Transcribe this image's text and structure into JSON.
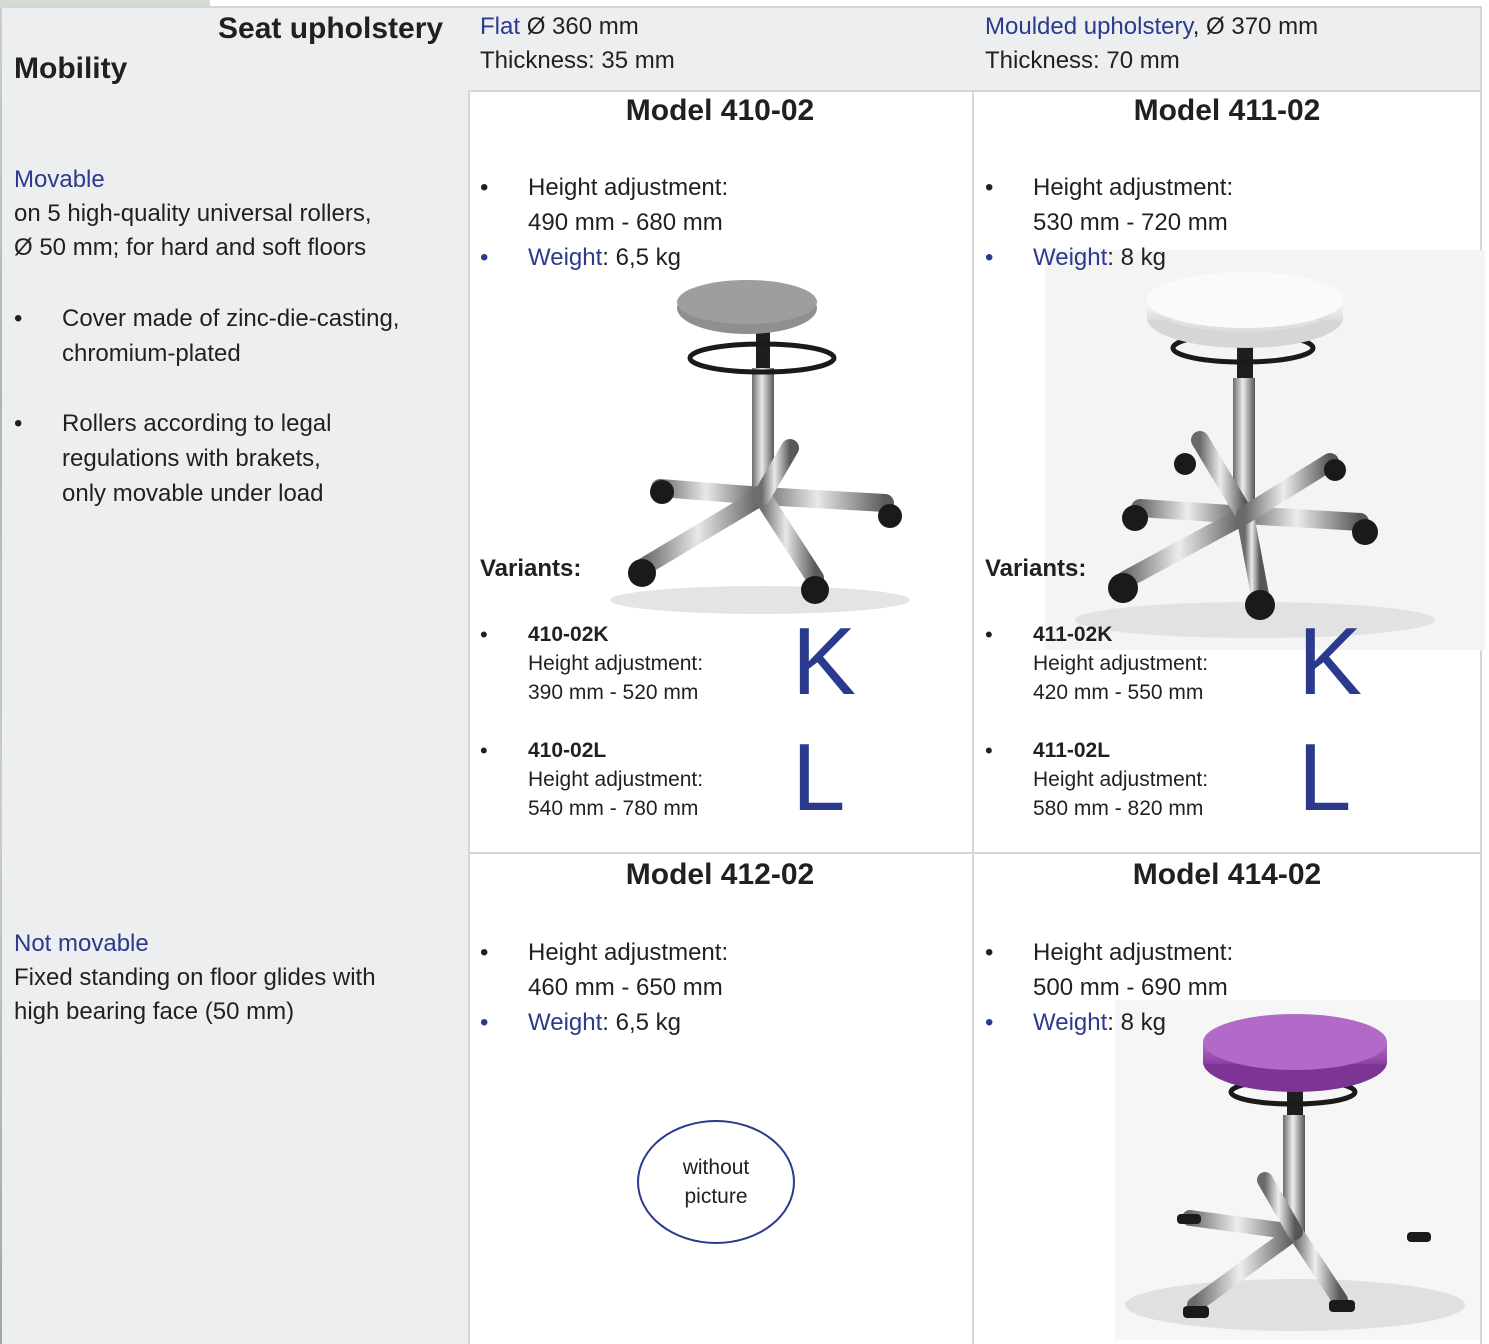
{
  "header": {
    "seat_upholstery_label": "Seat upholstery",
    "mobility_label": "Mobility",
    "flat": {
      "name": "Flat",
      "dimension": "Ø 360 mm",
      "thickness": "Thickness: 35 mm"
    },
    "moulded": {
      "name": "Moulded upholstery",
      "dimension": ", Ø 370 mm",
      "thickness": "Thickness: 70 mm"
    }
  },
  "mobility": {
    "movable": {
      "title": "Movable",
      "line1": "on 5 high-quality universal rollers,",
      "line2": "Ø 50 mm; for hard and soft floors",
      "bullets": [
        {
          "line1": "Cover made of zinc-die-casting,",
          "line2": "chromium-plated"
        },
        {
          "line1": "Rollers according to legal",
          "line2": "regulations with brakets,",
          "line3": "only movable under load"
        }
      ]
    },
    "not_movable": {
      "title": "Not movable",
      "line1": "Fixed standing on floor glides with",
      "line2": "high bearing face (50 mm)"
    }
  },
  "models": {
    "m41002": {
      "title": "Model 410-02",
      "height_label": "Height adjustment:",
      "height_value": "490 mm - 680 mm",
      "weight_label": "Weight",
      "weight_value": ": 6,5 kg",
      "variants_label": "Variants:",
      "variants": [
        {
          "code": "410-02K",
          "label": "Height adjustment:",
          "range": "390 mm - 520 mm",
          "letter": "K"
        },
        {
          "code": "410-02L",
          "label": "Height adjustment:",
          "range": "540 mm - 780 mm",
          "letter": "L"
        }
      ]
    },
    "m41102": {
      "title": "Model 411-02",
      "height_label": "Height adjustment:",
      "height_value": "530 mm - 720 mm",
      "weight_label": "Weight",
      "weight_value": ": 8 kg",
      "variants_label": "Variants:",
      "variants": [
        {
          "code": "411-02K",
          "label": "Height adjustment:",
          "range": "420 mm - 550 mm",
          "letter": "K"
        },
        {
          "code": "411-02L",
          "label": "Height adjustment:",
          "range": "580 mm - 820 mm",
          "letter": "L"
        }
      ]
    },
    "m41202": {
      "title": "Model 412-02",
      "height_label": "Height adjustment:",
      "height_value": "460 mm - 650 mm",
      "weight_label": "Weight",
      "weight_value": ": 6,5 kg",
      "no_picture_line1": "without",
      "no_picture_line2": "picture"
    },
    "m41402": {
      "title": "Model 414-02",
      "height_label": "Height adjustment:",
      "height_value": "500 mm - 690 mm",
      "weight_label": "Weight",
      "weight_value": ": 8 kg"
    }
  },
  "colors": {
    "accent_blue": "#2b3a8c",
    "panel_gray": "#eceef0",
    "seat_gray": "#9a9a9a",
    "seat_white": "#f2f2f2",
    "seat_purple": "#a455bd"
  }
}
